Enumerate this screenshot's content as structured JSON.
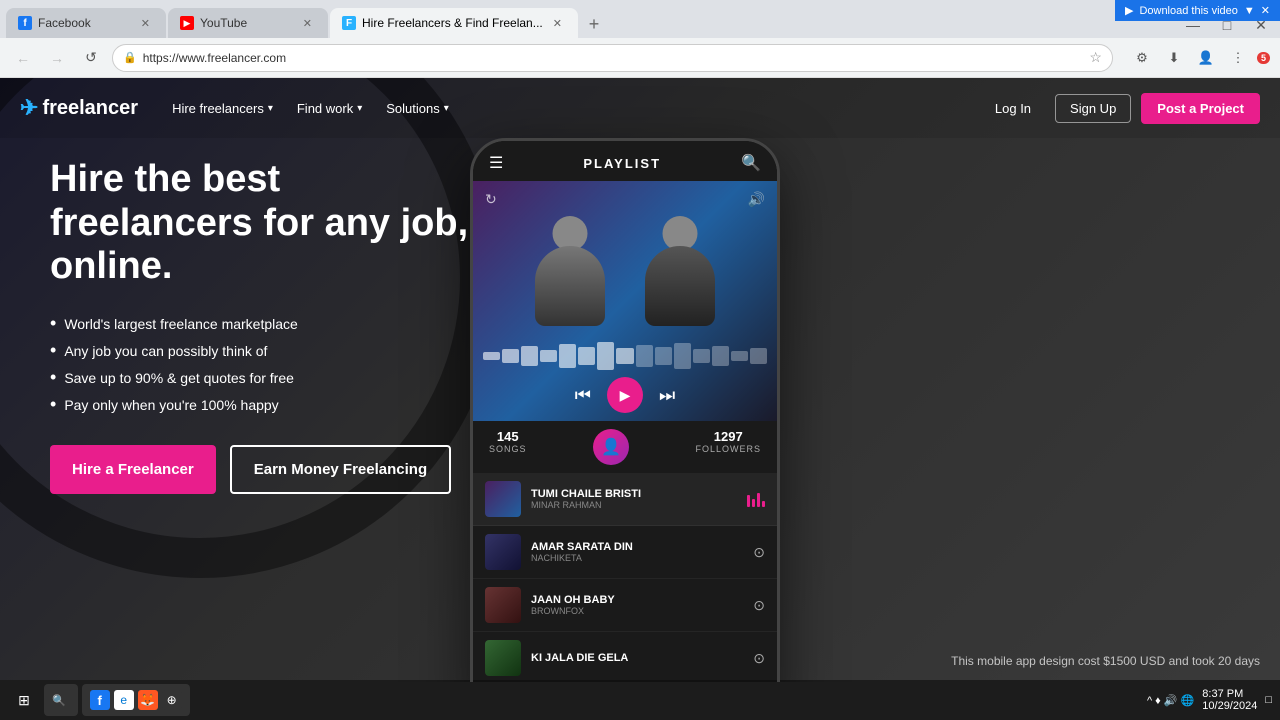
{
  "browser": {
    "tabs": [
      {
        "id": "tab-facebook",
        "label": "Facebook",
        "icon_color": "#1877f2",
        "icon_char": "f",
        "active": false
      },
      {
        "id": "tab-youtube",
        "label": "YouTube",
        "icon_color": "#ff0000",
        "icon_char": "▶",
        "active": false
      },
      {
        "id": "tab-freelancer",
        "label": "Hire Freelancers & Find Freelan...",
        "icon_color": "#29b2fe",
        "icon_char": "F",
        "active": true
      }
    ],
    "url": "https://www.freelancer.com",
    "new_tab_title": "+",
    "download_bar": "Download this video ▼ ✕"
  },
  "nav": {
    "logo_text": "freelancer",
    "links": [
      {
        "label": "Hire freelancers",
        "has_arrow": true
      },
      {
        "label": "Find work",
        "has_arrow": true
      },
      {
        "label": "Solutions",
        "has_arrow": true
      }
    ],
    "login_label": "Log In",
    "signup_label": "Sign Up",
    "post_label": "Post a Project"
  },
  "hero": {
    "title": "Hire the best freelancers for any job, online.",
    "bullets": [
      "World's largest freelance marketplace",
      "Any job you can possibly think of",
      "Save up to 90% & get quotes for free",
      "Pay only when you're 100% happy"
    ],
    "btn_hire": "Hire a Freelancer",
    "btn_earn": "Earn Money Freelancing"
  },
  "mobile": {
    "playlist_title": "PLAYLIST",
    "stats": {
      "songs_count": "145",
      "songs_label": "SONGS",
      "followers_count": "1297",
      "followers_label": "FOLLOWERS"
    },
    "songs": [
      {
        "name": "TUMI CHAILE BRISTI",
        "artist": "MINAR RAHMAN",
        "active": true
      },
      {
        "name": "AMAR SARATA DIN",
        "artist": "NACHIKETA",
        "active": false
      },
      {
        "name": "JAAN OH BABY",
        "artist": "BROWNFOX",
        "active": false
      },
      {
        "name": "KI JALA DIE GELA",
        "artist": "",
        "active": false
      }
    ]
  },
  "footer": {
    "cost_note": "This mobile app design cost $1500 USD and took 20 days"
  },
  "statusbar": {
    "url": "https://www.freelancer.com/login"
  },
  "taskbar": {
    "time": "8:37 PM",
    "date": "10/29/2024",
    "apps": [
      {
        "label": "Search",
        "icon": "🔍"
      },
      {
        "label": "Start",
        "icon": "⊞"
      }
    ]
  }
}
